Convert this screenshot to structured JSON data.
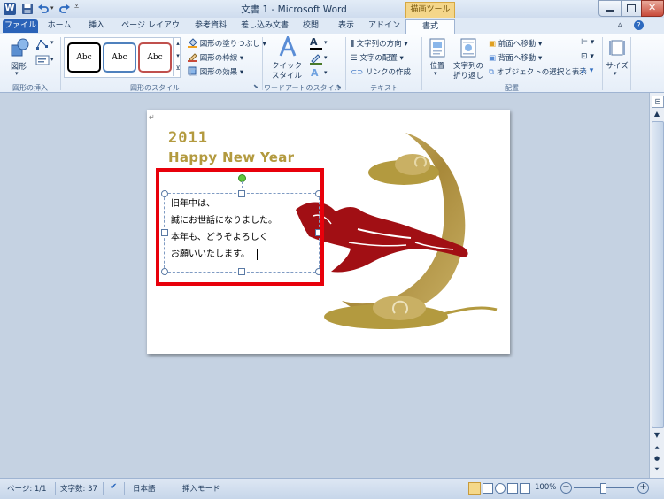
{
  "window": {
    "title": "文書 1 - Microsoft Word",
    "contextual_header": "描画ツール"
  },
  "tabs": [
    {
      "label": "ファイル"
    },
    {
      "label": "ホーム"
    },
    {
      "label": "挿入"
    },
    {
      "label": "ページ レイアウト"
    },
    {
      "label": "参考資料"
    },
    {
      "label": "差し込み文書"
    },
    {
      "label": "校閲"
    },
    {
      "label": "表示"
    },
    {
      "label": "アドイン"
    },
    {
      "label": "書式"
    }
  ],
  "ribbon": {
    "insert_shapes": {
      "shapes_label": "図形",
      "group_label": "図形の挿入"
    },
    "shape_styles": {
      "style_samples": [
        "Abc",
        "Abc",
        "Abc"
      ],
      "fill_label": "図形の塗りつぶし",
      "outline_label": "図形の枠線",
      "effects_label": "図形の効果",
      "group_label": "図形のスタイル"
    },
    "wordart": {
      "quick_styles_label_1": "クイック",
      "quick_styles_label_2": "スタイル",
      "group_label": "ワードアートのスタイル"
    },
    "text": {
      "direction_label": "文字列の方向",
      "align_label": "文字の配置",
      "link_label": "リンクの作成",
      "group_label": "テキスト"
    },
    "arrange": {
      "position_label": "位置",
      "wrap_label_1": "文字列の",
      "wrap_label_2": "折り返し",
      "bring_forward_label": "前面へ移動",
      "send_backward_label": "背面へ移動",
      "selection_pane_label": "オブジェクトの選択と表示",
      "group_label": "配置"
    },
    "size": {
      "label": "サイズ"
    }
  },
  "document": {
    "year": "2011",
    "greeting": "Happy New Year",
    "message_lines": [
      "旧年中は、",
      "誠にお世話になりました。",
      "本年も、どうぞよろしく",
      "お願いいたします。"
    ]
  },
  "statusbar": {
    "page": "ページ: 1/1",
    "word_count": "文字数: 37",
    "language": "日本語",
    "mode": "挿入モード",
    "zoom": "100%"
  },
  "colors": {
    "highlight_box": "#e8000b",
    "contextual_tab": "#f0c86e",
    "gold": "#b39a3f",
    "tiger": "#a10f14"
  }
}
